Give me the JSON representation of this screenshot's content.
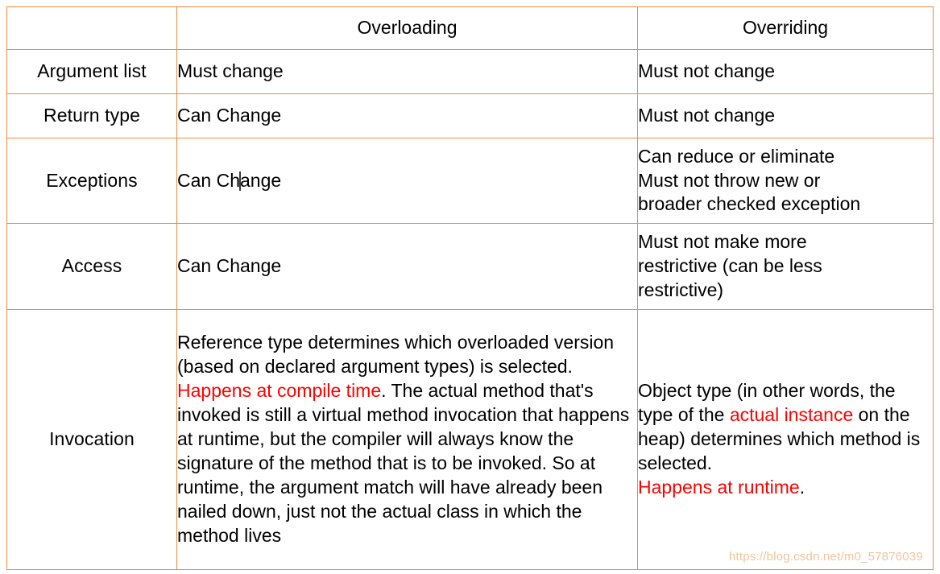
{
  "table": {
    "columns": [
      {
        "key": "label",
        "header": ""
      },
      {
        "key": "overloading",
        "header": "Overloading"
      },
      {
        "key": "overriding",
        "header": "Overriding"
      }
    ],
    "rows": [
      {
        "label": "Argument list",
        "overloading": "Must change",
        "overriding": "Must not change"
      },
      {
        "label": "Return type",
        "overloading": "Can Change",
        "overriding": "Must not change"
      },
      {
        "label": "Exceptions",
        "overloading_before_caret": "Can Ch",
        "overloading_after_caret": "ange",
        "overriding": "Can reduce or eliminate\nMust not throw new or\nbroader checked exception"
      },
      {
        "label": "Access",
        "overloading": "Can Change",
        "overriding": "Must not make more\nrestrictive (can be less\nrestrictive)"
      },
      {
        "label": "Invocation",
        "overloading_part1": "Reference type determines which overloaded version (based on declared argument types) is selected. ",
        "overloading_highlight": "Happens at compile time",
        "overloading_part2": ". The actual method that's invoked is still a virtual method invocation that happens at runtime, but the compiler will always know the signature of the method that is to be invoked. So at runtime, the argument match will have already been nailed down, just not the actual class in which the method lives",
        "overriding_part1": "Object type (in other words, the type of the ",
        "overriding_highlight1": "actual instance",
        "overriding_part2": " on the heap) determines which method is selected.",
        "overriding_highlight2": "Happens at runtime",
        "overriding_part3": "."
      }
    ]
  },
  "watermark": {
    "text": "https://blog.csdn.net/m0_57876039"
  },
  "colors": {
    "border": "#f58a3c",
    "highlight": "#ff0000",
    "text": "#000000",
    "background": "#ffffff",
    "watermark": "#f2b98a"
  }
}
